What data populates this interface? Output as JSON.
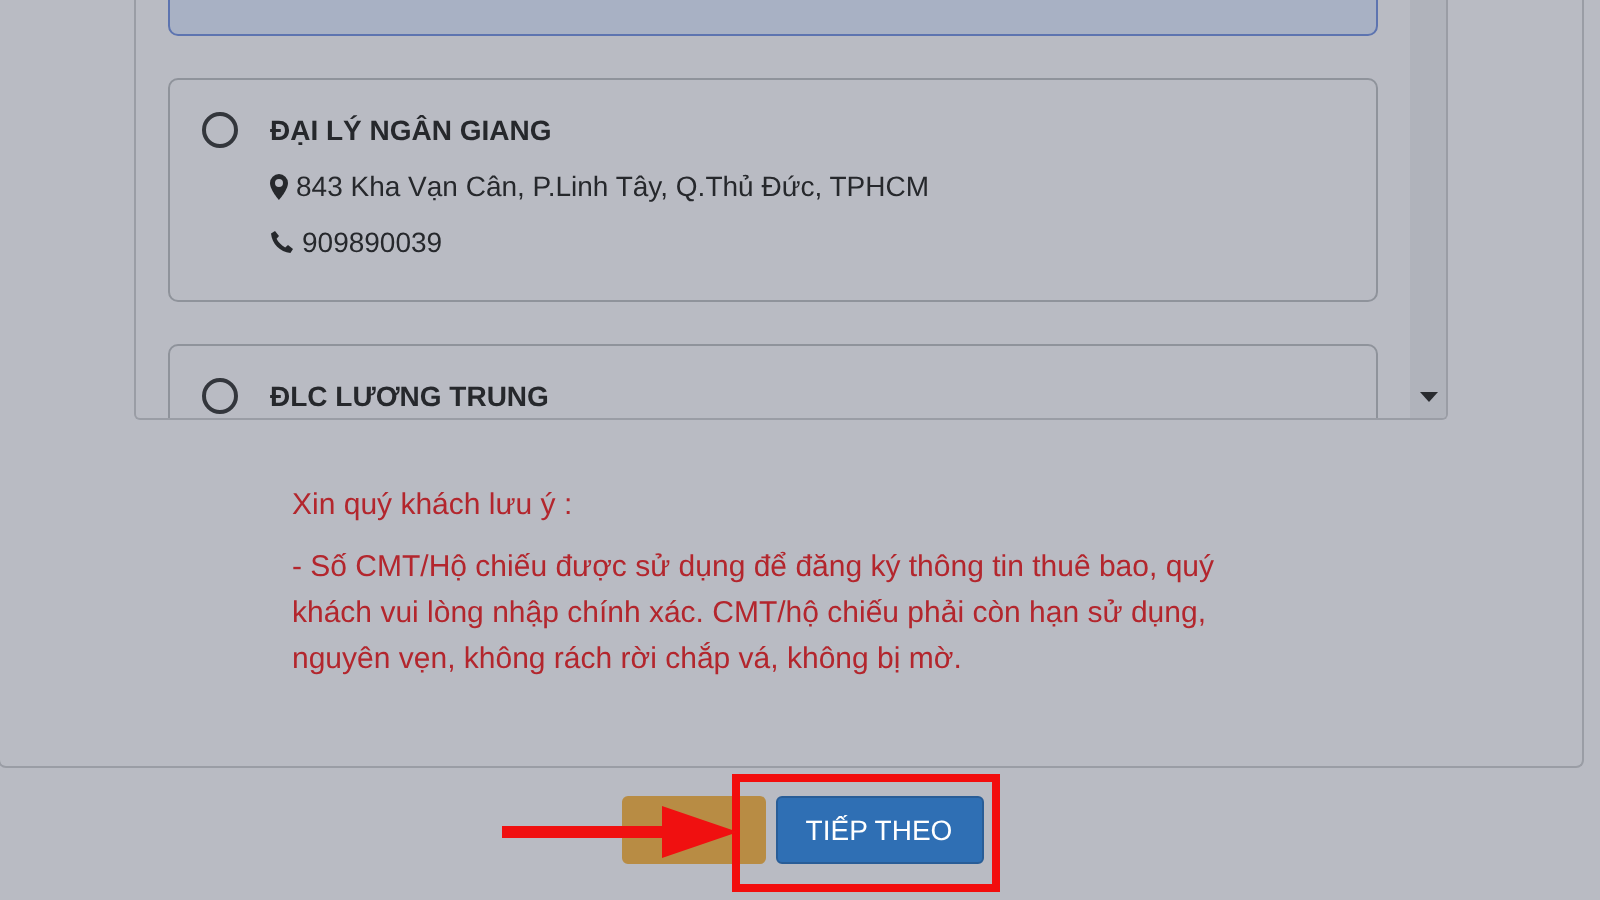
{
  "agents": [
    {
      "selected": true
    },
    {
      "selected": false,
      "name": "ĐẠI LÝ NGÂN GIANG",
      "address": "843 Kha Vạn Cân, P.Linh Tây, Q.Thủ Đức, TPHCM",
      "phone": "909890039"
    },
    {
      "selected": false,
      "name": "ĐLC LƯƠNG TRUNG"
    }
  ],
  "notice": {
    "title": "Xin quý khách lưu ý :",
    "body": "- Số CMT/Hộ chiếu được sử dụng để đăng ký thông tin thuê bao, quý khách vui lòng nhập chính xác. CMT/hộ chiếu phải còn hạn sử dụng, nguyên vẹn, không rách rời chắp vá, không bị mờ."
  },
  "buttons": [
    {
      "kind": "cancel"
    },
    {
      "kind": "next",
      "label": "TIẾP THEO",
      "highlighted": true
    }
  ]
}
